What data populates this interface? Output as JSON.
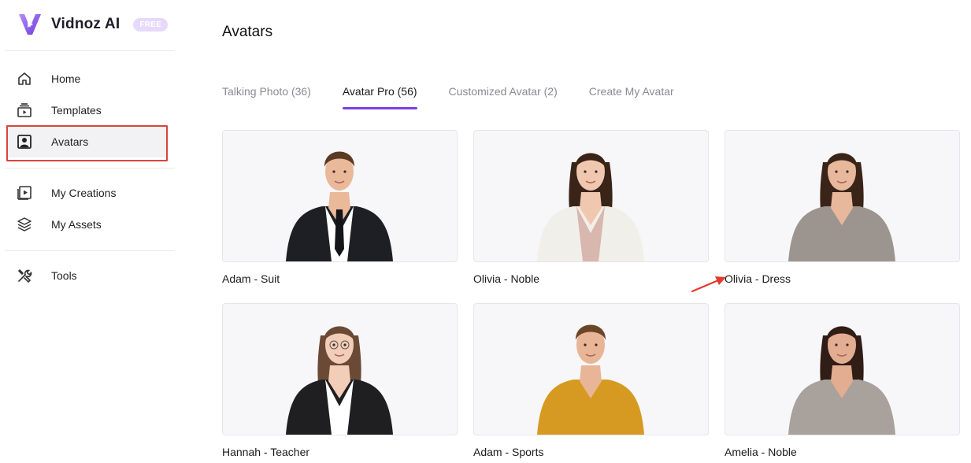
{
  "brand": {
    "name": "Vidnoz AI",
    "badge": "FREE",
    "accent": "#7b3fe4"
  },
  "sidebar": {
    "items": [
      {
        "label": "Home",
        "icon": "home-icon"
      },
      {
        "label": "Templates",
        "icon": "templates-icon"
      },
      {
        "label": "Avatars",
        "icon": "avatar-icon",
        "active": true
      },
      {
        "label": "My Creations",
        "icon": "play-icon"
      },
      {
        "label": "My Assets",
        "icon": "layers-icon"
      },
      {
        "label": "Tools",
        "icon": "tools-icon"
      }
    ]
  },
  "main": {
    "title": "Avatars",
    "tabs": [
      {
        "label": "Talking Photo (36)"
      },
      {
        "label": "Avatar Pro (56)",
        "active": true
      },
      {
        "label": "Customized Avatar (2)"
      },
      {
        "label": "Create My Avatar"
      }
    ],
    "avatars": [
      {
        "name": "Adam - Suit",
        "outfit": "#1d1f24",
        "shirt": "#ffffff",
        "hair": "#5a3a22",
        "skin": "#e9b99a",
        "tie": true
      },
      {
        "name": "Olivia - Noble",
        "outfit": "#f1efe9",
        "shirt": "#d8b7ae",
        "hair": "#3a2418",
        "skin": "#f0c8b0",
        "tie": false
      },
      {
        "name": "Olivia - Dress",
        "outfit": "#9c958f",
        "shirt": "#9c958f",
        "hair": "#3a2418",
        "skin": "#e7b89b",
        "tie": false
      },
      {
        "name": "Hannah - Teacher",
        "outfit": "#1f1f22",
        "shirt": "#ffffff",
        "hair": "#6b4a35",
        "skin": "#f2cdb7",
        "tie": false
      },
      {
        "name": "Adam - Sports",
        "outfit": "#d69a22",
        "shirt": "#d69a22",
        "hair": "#6a4526",
        "skin": "#e8b596",
        "tie": false
      },
      {
        "name": "Amelia - Noble",
        "outfit": "#a9a19b",
        "shirt": "#a9a19b",
        "hair": "#2f1d16",
        "skin": "#e2ad91",
        "tie": false
      }
    ]
  }
}
